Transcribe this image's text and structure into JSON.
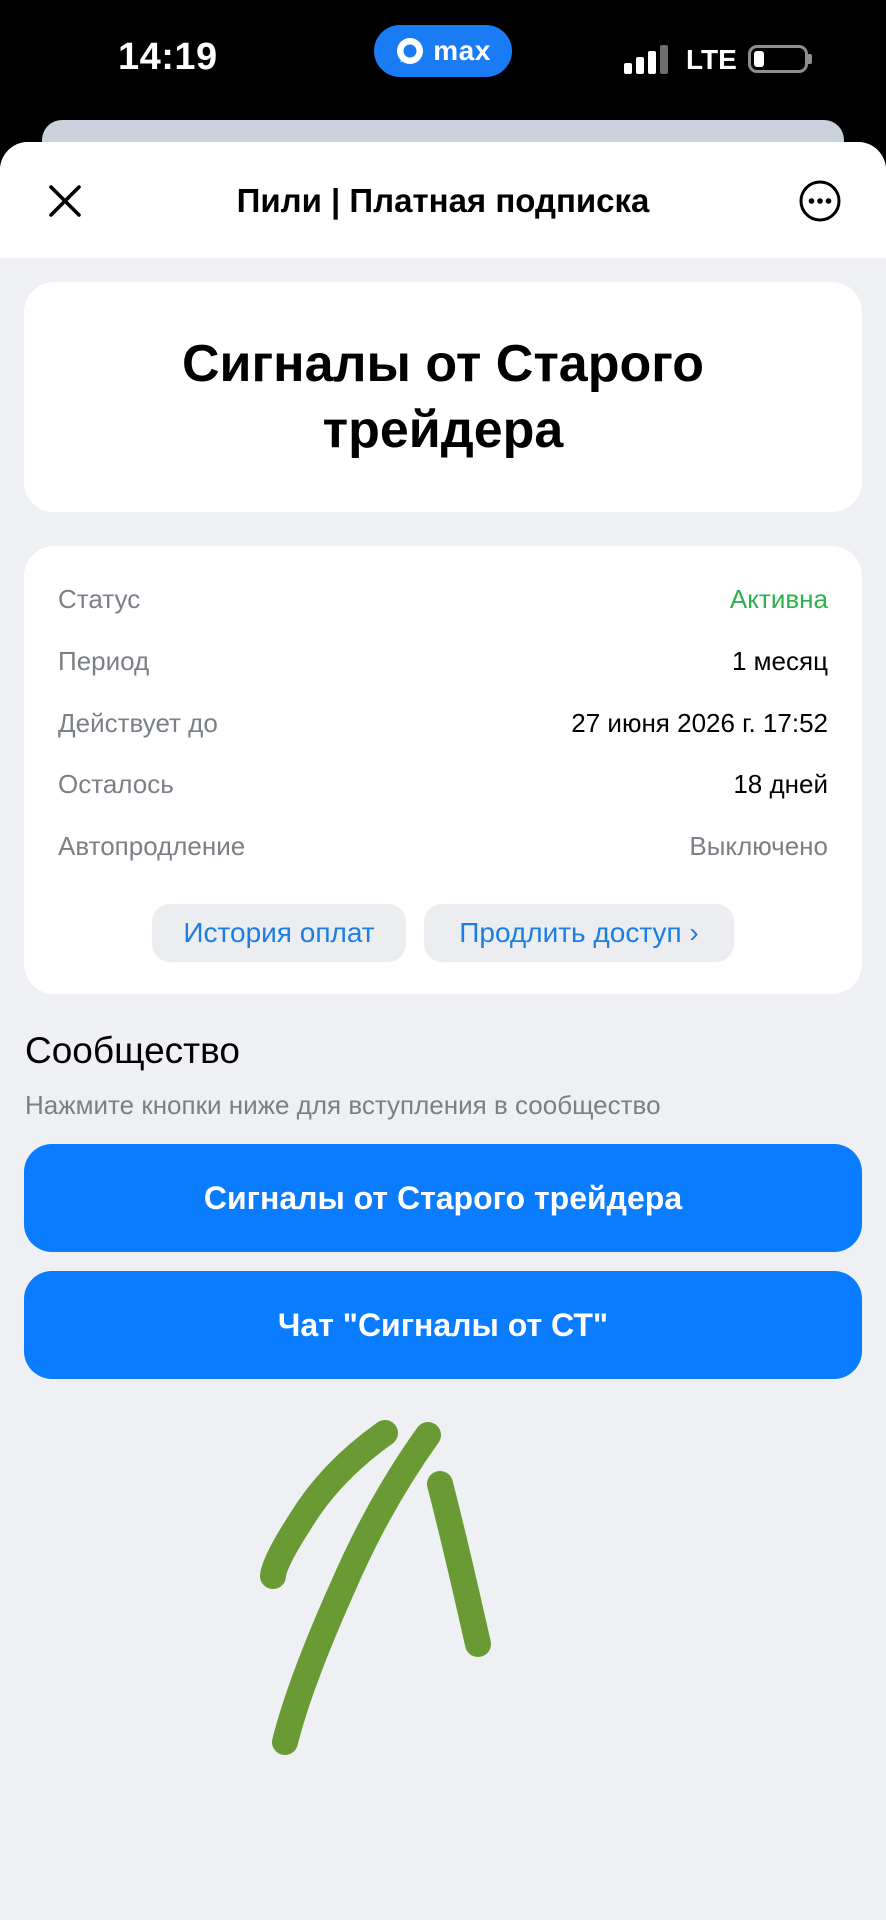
{
  "status_bar": {
    "time": "14:19",
    "app_pill_label": "max",
    "network": "LTE"
  },
  "header": {
    "title": "Пили | Платная подписка"
  },
  "subscription": {
    "name": "Сигналы от Старого трейдера",
    "rows": [
      {
        "label": "Статус",
        "value": "Активна"
      },
      {
        "label": "Период",
        "value": "1 месяц"
      },
      {
        "label": "Действует до",
        "value": "27 июня 2026 г. 17:52"
      },
      {
        "label": "Осталось",
        "value": "18 дней"
      },
      {
        "label": "Автопродление",
        "value": "Выключено"
      }
    ],
    "history_button": "История оплат",
    "extend_button": "Продлить доступ ›"
  },
  "community": {
    "title": "Сообщество",
    "subtitle": "Нажмите кнопки ниже для вступления в сообщество",
    "buttons": [
      {
        "label": "Сигналы от Старого трейдера"
      },
      {
        "label": "Чат \"Сигналы от СТ\""
      }
    ]
  },
  "colors": {
    "accent": "#0a7cff",
    "status_active": "#2cb24b",
    "annotation": "#6a9a34"
  },
  "icons": {
    "close": "close-icon",
    "more": "more-icon",
    "app_logo": "max-logo-icon"
  }
}
